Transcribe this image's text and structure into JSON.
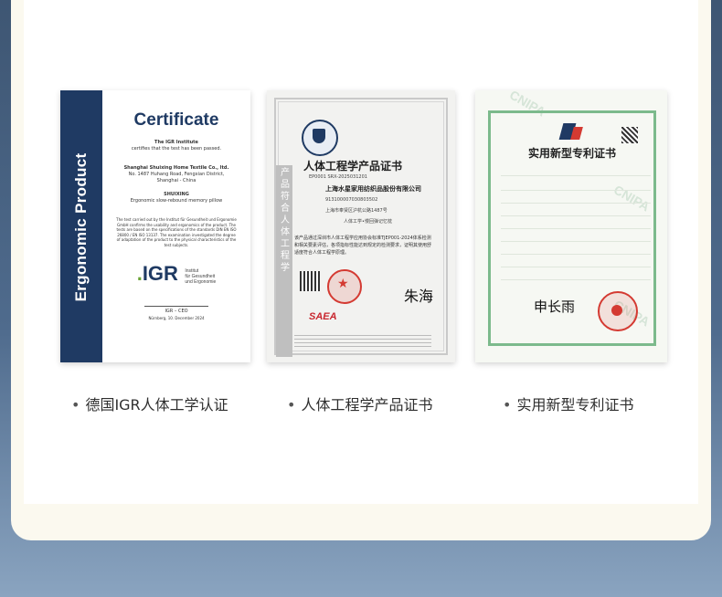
{
  "certificates": [
    {
      "side_text": "Ergonomic Product",
      "title": "Certificate",
      "issuer_line1": "The IGR Institute",
      "issuer_line2": "certifies that the test has been passed.",
      "company": "Shanghai Shuixing Home Textile Co., ltd.",
      "address1": "No. 1487 Huhang Road, Fengxian District,",
      "address2": "Shanghai - China",
      "brand": "SHUIXING",
      "product": "Ergonomic slow-rebound memory pillow",
      "body_text": "The test carried out by the Institut für Gesundheit und Ergonomie GmbH confirms the usability and ergonomics of the product. The tests are based on the specifications of the standards DIN EN ISO 26800 / EN ISO 13137. The examination investigated the degree of adaptation of the product to the physical characteristics of the test subjects.",
      "logo_text": "IGR",
      "logo_sub1": "Institut",
      "logo_sub2": "für Gesundheit",
      "logo_sub3": "und Ergonomie",
      "signer": "IGR – CEO",
      "date": "Nürnberg, 10. December 2024",
      "caption": "德国IGR人体工学认证"
    },
    {
      "side_text": "产品符合人体工程学",
      "title": "人体工程学产品证书",
      "cert_no": "EP0001 SRX-2025031201",
      "company": "上海水星家用纺织品股份有限公司",
      "code": "913100007030803502",
      "address": "上海市奉贤区沪杭公路1487号",
      "product_line": "人体工学•慢回弹记忆枕",
      "body_text": "该产品通过深圳市人体工程学应用协会标准TJEP001-2024体系检测和相关要素评估，各项指标性能达到规定的检测要求，证明其使用舒适度符合人体工程学原理。",
      "saea": "SAEA",
      "signature": "朱海",
      "caption": "人体工程学产品证书"
    },
    {
      "title": "实用新型专利证书",
      "signature": "申长雨",
      "watermark": "CNIPA",
      "caption": "实用新型专利证书"
    }
  ],
  "bullet": "•"
}
